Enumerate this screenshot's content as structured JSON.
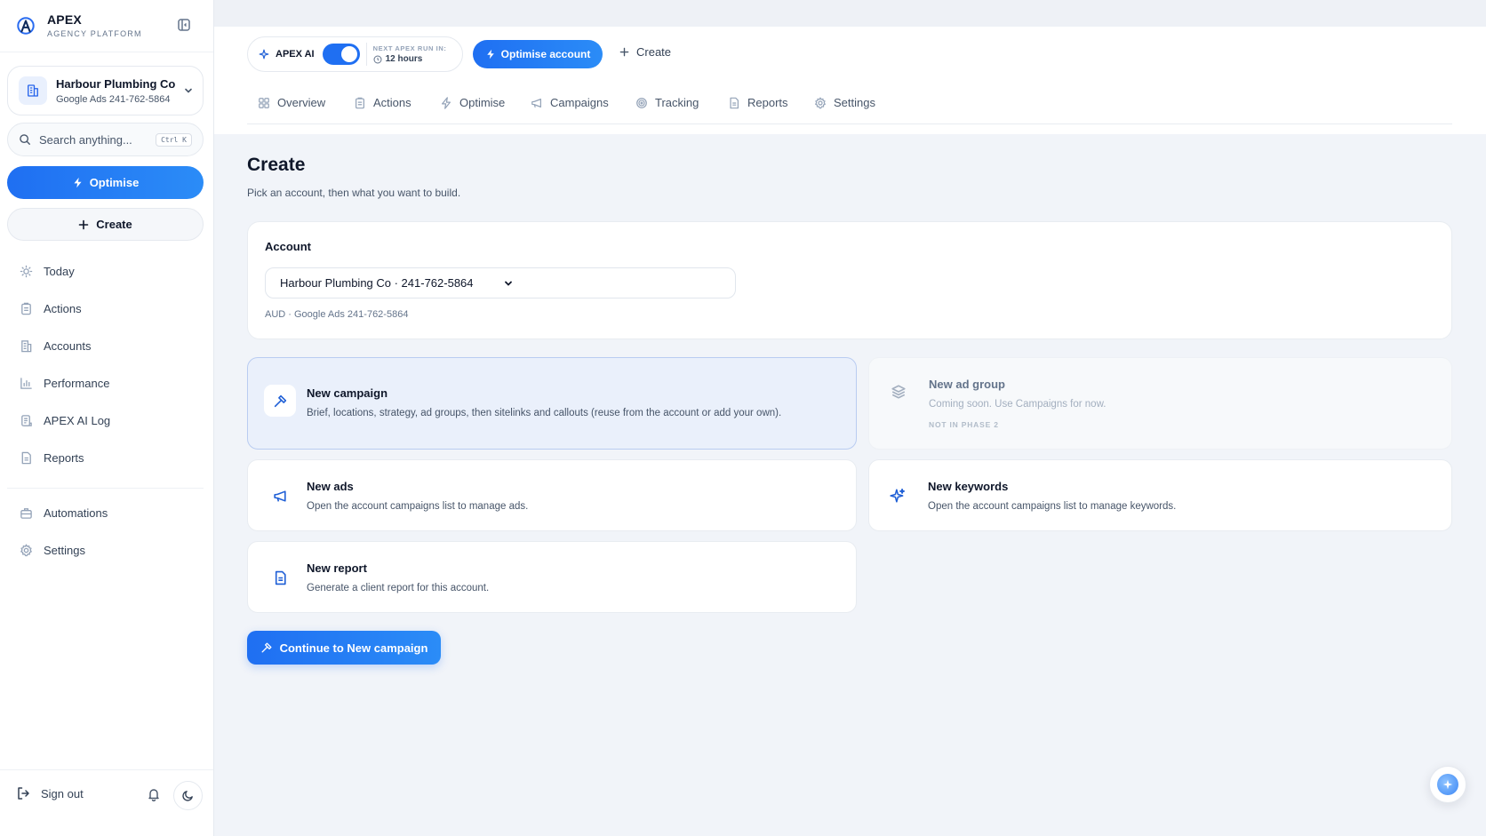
{
  "brand": {
    "name": "APEX",
    "subtitle": "AGENCY PLATFORM"
  },
  "account_switcher": {
    "name": "Harbour Plumbing Co",
    "detail": "Google Ads 241-762-5864"
  },
  "search": {
    "placeholder": "Search anything...",
    "shortcut": "Ctrl K"
  },
  "sidebar": {
    "optimise_label": "Optimise",
    "create_label": "Create",
    "items": [
      {
        "label": "Today",
        "icon": "sun-icon"
      },
      {
        "label": "Actions",
        "icon": "clipboard-icon"
      },
      {
        "label": "Accounts",
        "icon": "building-icon"
      },
      {
        "label": "Performance",
        "icon": "bar-chart-icon"
      },
      {
        "label": "APEX AI Log",
        "icon": "scroll-icon"
      },
      {
        "label": "Reports",
        "icon": "document-icon"
      }
    ],
    "secondary": [
      {
        "label": "Automations",
        "icon": "briefcase-icon"
      },
      {
        "label": "Settings",
        "icon": "gear-icon"
      }
    ],
    "sign_out_label": "Sign out"
  },
  "header": {
    "ai_label": "APEX AI",
    "ai_enabled": true,
    "next_run_label": "NEXT APEX RUN IN:",
    "next_run_value": "12 hours",
    "optimise_account_label": "Optimise account",
    "create_label": "Create",
    "tabs": [
      {
        "label": "Overview",
        "icon": "grid-icon"
      },
      {
        "label": "Actions",
        "icon": "clipboard-icon"
      },
      {
        "label": "Optimise",
        "icon": "bolt-icon"
      },
      {
        "label": "Campaigns",
        "icon": "megaphone-icon"
      },
      {
        "label": "Tracking",
        "icon": "target-icon"
      },
      {
        "label": "Reports",
        "icon": "document-icon"
      },
      {
        "label": "Settings",
        "icon": "gear-icon"
      }
    ]
  },
  "page": {
    "title": "Create",
    "subtitle": "Pick an account, then what you want to build."
  },
  "account_panel": {
    "label": "Account",
    "selected": "Harbour Plumbing Co · 241-762-5864",
    "meta": "AUD · Google Ads 241-762-5864"
  },
  "options": {
    "new_campaign": {
      "title": "New campaign",
      "desc": "Brief, locations, strategy, ad groups, then sitelinks and callouts (reuse from the account or add your own).",
      "icon": "hammer-icon"
    },
    "new_ad_group": {
      "title": "New ad group",
      "desc": "Coming soon. Use Campaigns for now.",
      "tag": "NOT IN PHASE 2",
      "icon": "layers-icon"
    },
    "new_ads": {
      "title": "New ads",
      "desc": "Open the account campaigns list to manage ads.",
      "icon": "megaphone-icon"
    },
    "new_keywords": {
      "title": "New keywords",
      "desc": "Open the account campaigns list to manage keywords.",
      "icon": "sparkle-icon"
    },
    "new_report": {
      "title": "New report",
      "desc": "Generate a client report for this account.",
      "icon": "document-icon"
    }
  },
  "continue_label": "Continue to New campaign",
  "colors": {
    "accent": "#1f6ff2",
    "selected_card_bg": "#eaf0fb",
    "page_bg": "#f1f4f9"
  }
}
